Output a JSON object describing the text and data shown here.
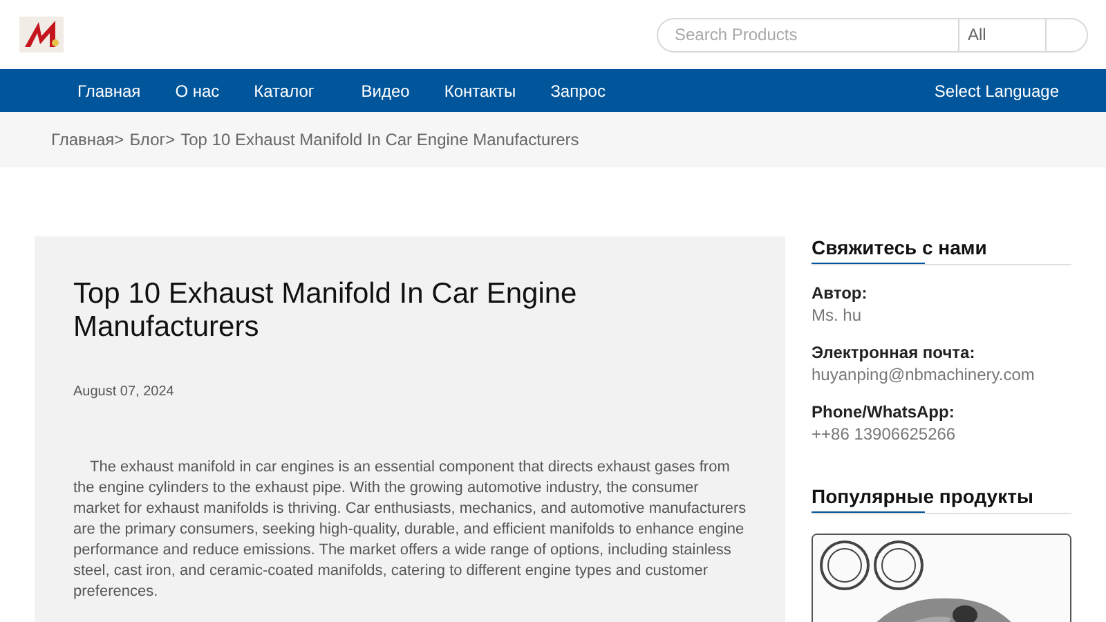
{
  "header": {
    "search": {
      "placeholder": "Search Products",
      "category": "All"
    }
  },
  "nav": {
    "items": [
      "Главная",
      "О нас",
      "Каталог",
      "Видео",
      "Контакты",
      "Запрос"
    ],
    "language": "Select Language"
  },
  "breadcrumb": [
    "Главная>",
    "Блог>",
    "Top 10 Exhaust Manifold In Car Engine Manufacturers"
  ],
  "article": {
    "title": "Top 10 Exhaust Manifold In Car Engine Manufacturers",
    "date": "August 07, 2024",
    "body": "The exhaust manifold in car engines is an essential component that directs exhaust gases from the engine cylinders to the exhaust pipe. With the growing automotive industry, the consumer market for exhaust manifolds is thriving. Car enthusiasts, mechanics, and automotive manufacturers are the primary consumers, seeking high-quality, durable, and efficient manifolds to enhance engine performance and reduce emissions. The market offers a wide range of options, including stainless steel, cast iron, and ceramic-coated manifolds, catering to different engine types and customer preferences."
  },
  "sidebar": {
    "contact": {
      "heading": "Свяжитесь с нами",
      "fields": [
        {
          "label": "Автор:",
          "value": "Ms. hu"
        },
        {
          "label": "Электронная почта:",
          "value": "huyanping@nbmachinery.com"
        },
        {
          "label": "Phone/WhatsApp:",
          "value": "++86 13906625266"
        }
      ]
    },
    "products": {
      "heading": "Популярные продукты"
    }
  }
}
